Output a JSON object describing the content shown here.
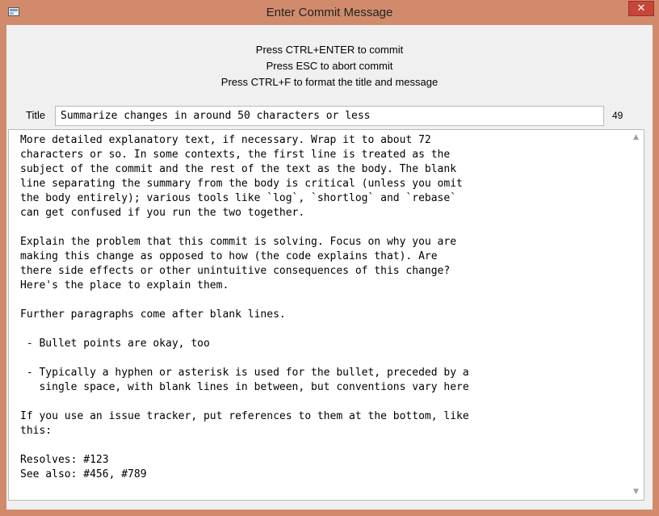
{
  "window": {
    "title": "Enter Commit Message",
    "close_glyph": "✕"
  },
  "hints": [
    "Press CTRL+ENTER to commit",
    "Press ESC to abort commit",
    "Press CTRL+F to format the title and message"
  ],
  "title_field": {
    "label": "Title",
    "value": "Summarize changes in around 50 characters or less",
    "char_count": "49"
  },
  "message": {
    "body": "More detailed explanatory text, if necessary. Wrap it to about 72\ncharacters or so. In some contexts, the first line is treated as the\nsubject of the commit and the rest of the text as the body. The blank\nline separating the summary from the body is critical (unless you omit\nthe body entirely); various tools like `log`, `shortlog` and `rebase`\ncan get confused if you run the two together.\n\nExplain the problem that this commit is solving. Focus on why you are\nmaking this change as opposed to how (the code explains that). Are\nthere side effects or other unintuitive consequences of this change?\nHere's the place to explain them.\n\nFurther paragraphs come after blank lines.\n\n - Bullet points are okay, too\n\n - Typically a hyphen or asterisk is used for the bullet, preceded by a\n   single space, with blank lines in between, but conventions vary here\n\nIf you use an issue tracker, put references to them at the bottom, like\nthis:\n\nResolves: #123\nSee also: #456, #789"
  },
  "scrollbar": {
    "up_glyph": "▲",
    "down_glyph": "▼"
  }
}
